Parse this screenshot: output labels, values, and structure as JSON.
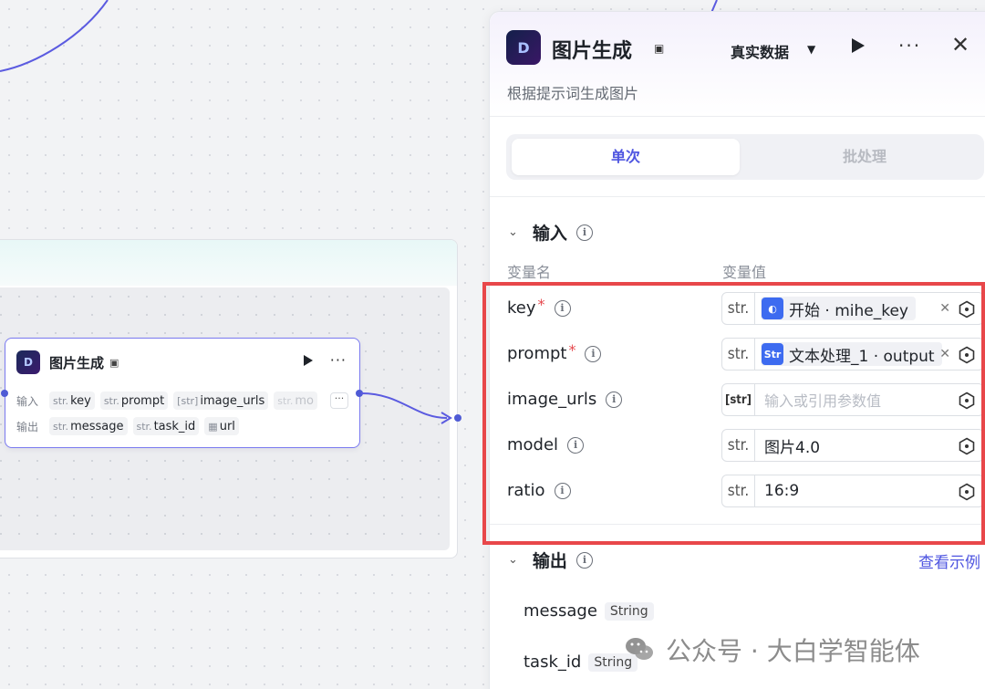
{
  "canvas": {
    "node": {
      "title": "图片生成",
      "logo_text": "D",
      "input_label": "输入",
      "output_label": "输出",
      "inputs": [
        {
          "type": "str.",
          "name": "key"
        },
        {
          "type": "str.",
          "name": "prompt"
        },
        {
          "type": "[str]",
          "name": "image_urls"
        },
        {
          "type": "str.",
          "name": "mo"
        }
      ],
      "more_inputs": "···",
      "outputs": [
        {
          "type": "str.",
          "name": "message"
        },
        {
          "type": "str.",
          "name": "task_id"
        },
        {
          "type": "img",
          "name": "url"
        }
      ]
    }
  },
  "panel": {
    "title": "图片生成",
    "logo_text": "D",
    "data_mode": "真实数据",
    "description": "根据提示词生成图片",
    "tabs": {
      "single": "单次",
      "batch": "批处理"
    },
    "input_section": {
      "title": "输入",
      "col_name": "变量名",
      "col_value": "变量值",
      "params": [
        {
          "name": "key",
          "required": true,
          "type": "str.",
          "ref": {
            "icon": "start-icon",
            "text": "开始 · mihe_key"
          }
        },
        {
          "name": "prompt",
          "required": true,
          "type": "str.",
          "ref": {
            "icon": "text-process-icon",
            "text": "文本处理_1 · output"
          }
        },
        {
          "name": "image_urls",
          "required": false,
          "type": "[str]",
          "placeholder": "输入或引用参数值"
        },
        {
          "name": "model",
          "required": false,
          "type": "str.",
          "value": "图片4.0"
        },
        {
          "name": "ratio",
          "required": false,
          "type": "str.",
          "value": "16:9"
        }
      ]
    },
    "output_section": {
      "title": "输出",
      "view_example": "查看示例",
      "outputs": [
        {
          "name": "message",
          "type": "String"
        },
        {
          "name": "task_id",
          "type": "String"
        }
      ]
    }
  },
  "watermark": {
    "text": "公众号 · 大白学智能体"
  },
  "colors": {
    "accent": "#4e55e0",
    "edge": "#5b5be0",
    "highlight": "#e8474a",
    "required": "#e5484d"
  }
}
